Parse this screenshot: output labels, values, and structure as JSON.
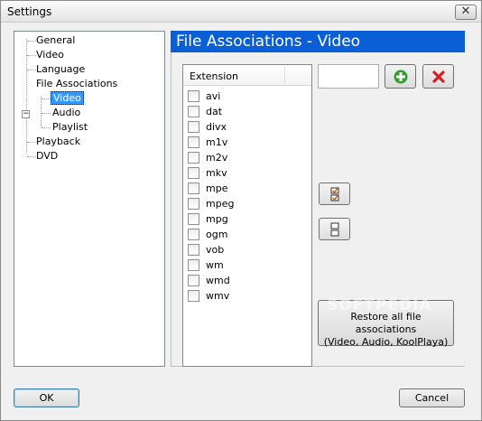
{
  "window": {
    "title": "Settings",
    "close_glyph": "✕"
  },
  "tree": {
    "items": [
      {
        "label": "General",
        "level": 0
      },
      {
        "label": "Video",
        "level": 0
      },
      {
        "label": "Language",
        "level": 0
      },
      {
        "label": "File Associations",
        "level": 0,
        "expanded": true,
        "expander": "−"
      },
      {
        "label": "Video",
        "level": 1,
        "selected": true
      },
      {
        "label": "Audio",
        "level": 1
      },
      {
        "label": "Playlist",
        "level": 1
      },
      {
        "label": "Playback",
        "level": 0
      },
      {
        "label": "DVD",
        "level": 0
      }
    ]
  },
  "panel": {
    "title": "File Associations - Video"
  },
  "extensions": {
    "header": "Extension",
    "items": [
      "avi",
      "dat",
      "divx",
      "m1v",
      "m2v",
      "mkv",
      "mpe",
      "mpeg",
      "mpg",
      "ogm",
      "vob",
      "wm",
      "wmd",
      "wmv"
    ]
  },
  "extension_input": {
    "value": ""
  },
  "buttons": {
    "add_icon": "green-plus-icon",
    "remove_icon": "red-x-icon",
    "check_all_icon": "check-all-icon",
    "uncheck_all_icon": "uncheck-all-icon",
    "restore_line1": "Restore all file associations",
    "restore_line2": "(Video, Audio, KoolPlaya)",
    "ok": "OK",
    "cancel": "Cancel"
  },
  "watermark": "SOFTPEDIA",
  "colors": {
    "header_blue": "#0b5fd6",
    "selection": "#3399ff",
    "add_green": "#2e9e2e",
    "remove_red": "#d32020"
  }
}
